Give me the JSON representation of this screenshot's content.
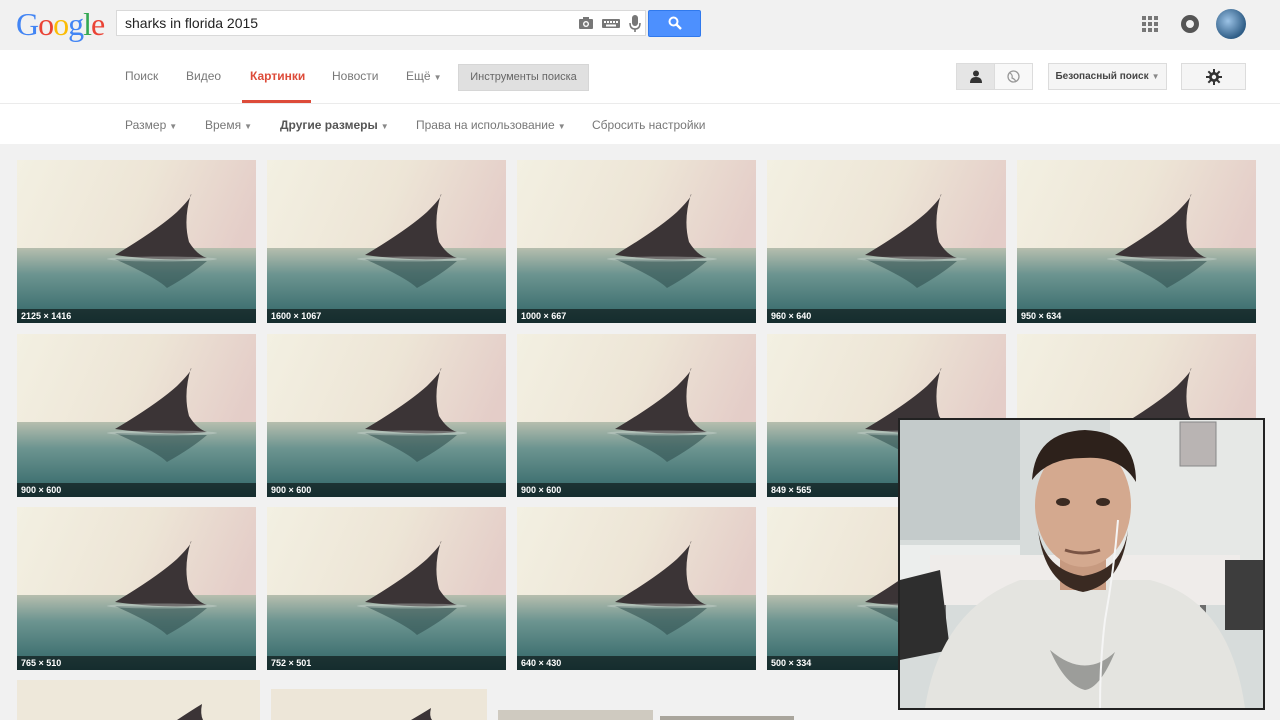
{
  "logo": {
    "letters": [
      "G",
      "o",
      "o",
      "g",
      "l",
      "e"
    ],
    "alt": "Google"
  },
  "search": {
    "query": "sharks in florida 2015"
  },
  "header_icons": [
    "camera-icon",
    "keyboard-icon",
    "microphone-icon",
    "search-icon",
    "apps-grid-icon",
    "notifications-icon",
    "avatar"
  ],
  "tabs": [
    {
      "label": "Поиск",
      "active": false
    },
    {
      "label": "Видео",
      "active": false
    },
    {
      "label": "Картинки",
      "active": true
    },
    {
      "label": "Новости",
      "active": false
    },
    {
      "label": "Ещё",
      "active": false
    }
  ],
  "tools_label": "Инструменты поиска",
  "safe_search_label": "Безопасный поиск",
  "filters": [
    {
      "label": "Размер",
      "bold": false
    },
    {
      "label": "Время",
      "bold": false
    },
    {
      "label": "Другие размеры",
      "bold": true
    },
    {
      "label": "Права на использование",
      "bold": false
    },
    {
      "label": "Сбросить настройки",
      "bold": false
    }
  ],
  "images": [
    {
      "dims": "2125 × 1416"
    },
    {
      "dims": "1600 × 1067"
    },
    {
      "dims": "1000 × 667"
    },
    {
      "dims": "960 × 640"
    },
    {
      "dims": "950 × 634"
    },
    {
      "dims": "900 × 600"
    },
    {
      "dims": "900 × 600"
    },
    {
      "dims": "900 × 600"
    },
    {
      "dims": "849 × 565"
    },
    {
      "dims": ""
    },
    {
      "dims": "765 × 510"
    },
    {
      "dims": "752 × 501"
    },
    {
      "dims": "640 × 430"
    },
    {
      "dims": "500 × 334"
    }
  ],
  "colors": {
    "active_tab": "#dd4b39",
    "search_button": "#4d90fe"
  }
}
